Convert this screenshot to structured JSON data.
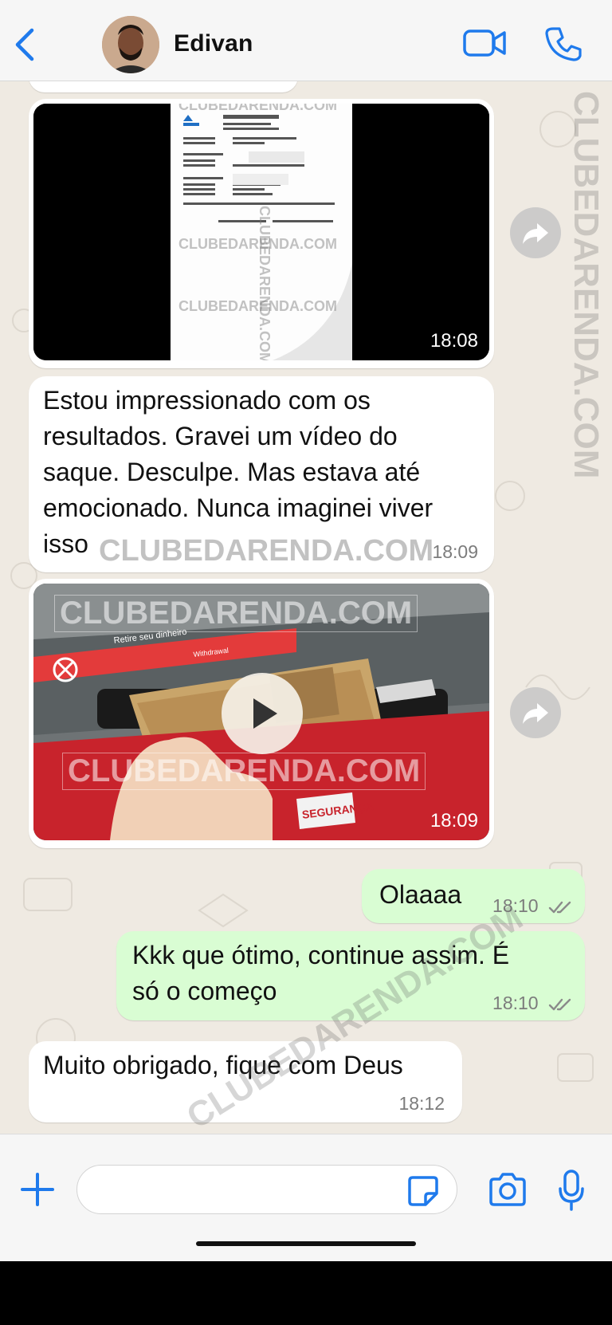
{
  "header": {
    "contact_name": "Edivan",
    "back_icon": "chevron-left-icon",
    "video_icon": "video-camera-icon",
    "call_icon": "phone-icon"
  },
  "messages": [
    {
      "type": "image",
      "direction": "in",
      "time": "18:08"
    },
    {
      "type": "text",
      "direction": "in",
      "text_lines": [
        "Estou impressionado com os",
        "resultados. Gravei um vídeo do",
        "saque. Desculpe. Mas estava até",
        "emocionado. Nunca imaginei viver",
        "isso"
      ],
      "time": "18:09"
    },
    {
      "type": "video",
      "direction": "in",
      "time": "18:09"
    },
    {
      "type": "text",
      "direction": "out",
      "text_lines": [
        "Olaaaa"
      ],
      "time": "18:10",
      "status": "read"
    },
    {
      "type": "text",
      "direction": "out",
      "text_lines": [
        "Kkk que ótimo, continue assim. É",
        "só o começo"
      ],
      "time": "18:10",
      "status": "read"
    },
    {
      "type": "text",
      "direction": "in",
      "text_lines": [
        "Muito obrigado, fique com Deus"
      ],
      "time": "18:12"
    }
  ],
  "receipt": {
    "title": "Recibo de Pagamento",
    "bank": "Banrisul",
    "footer": "SAC 0800 646 1515    OUVIDORIA 0800 644 2200"
  },
  "atm": {
    "sticker_text": "Retire seu dinheiro",
    "sticker_sub": "Withdrawal",
    "sticker_side": "SEGURANÇA"
  },
  "watermark": "CLUBEDARENDA.COM",
  "input_bar": {
    "placeholder": "",
    "plus_icon": "plus-icon",
    "sticker_icon": "sticker-icon",
    "camera_icon": "camera-icon",
    "mic_icon": "microphone-icon"
  },
  "colors": {
    "accent": "#1f7aec",
    "chat_bg": "#efeae2",
    "incoming_bubble": "#ffffff",
    "outgoing_bubble": "#d9fdd3",
    "atm_red": "#c8232c"
  }
}
